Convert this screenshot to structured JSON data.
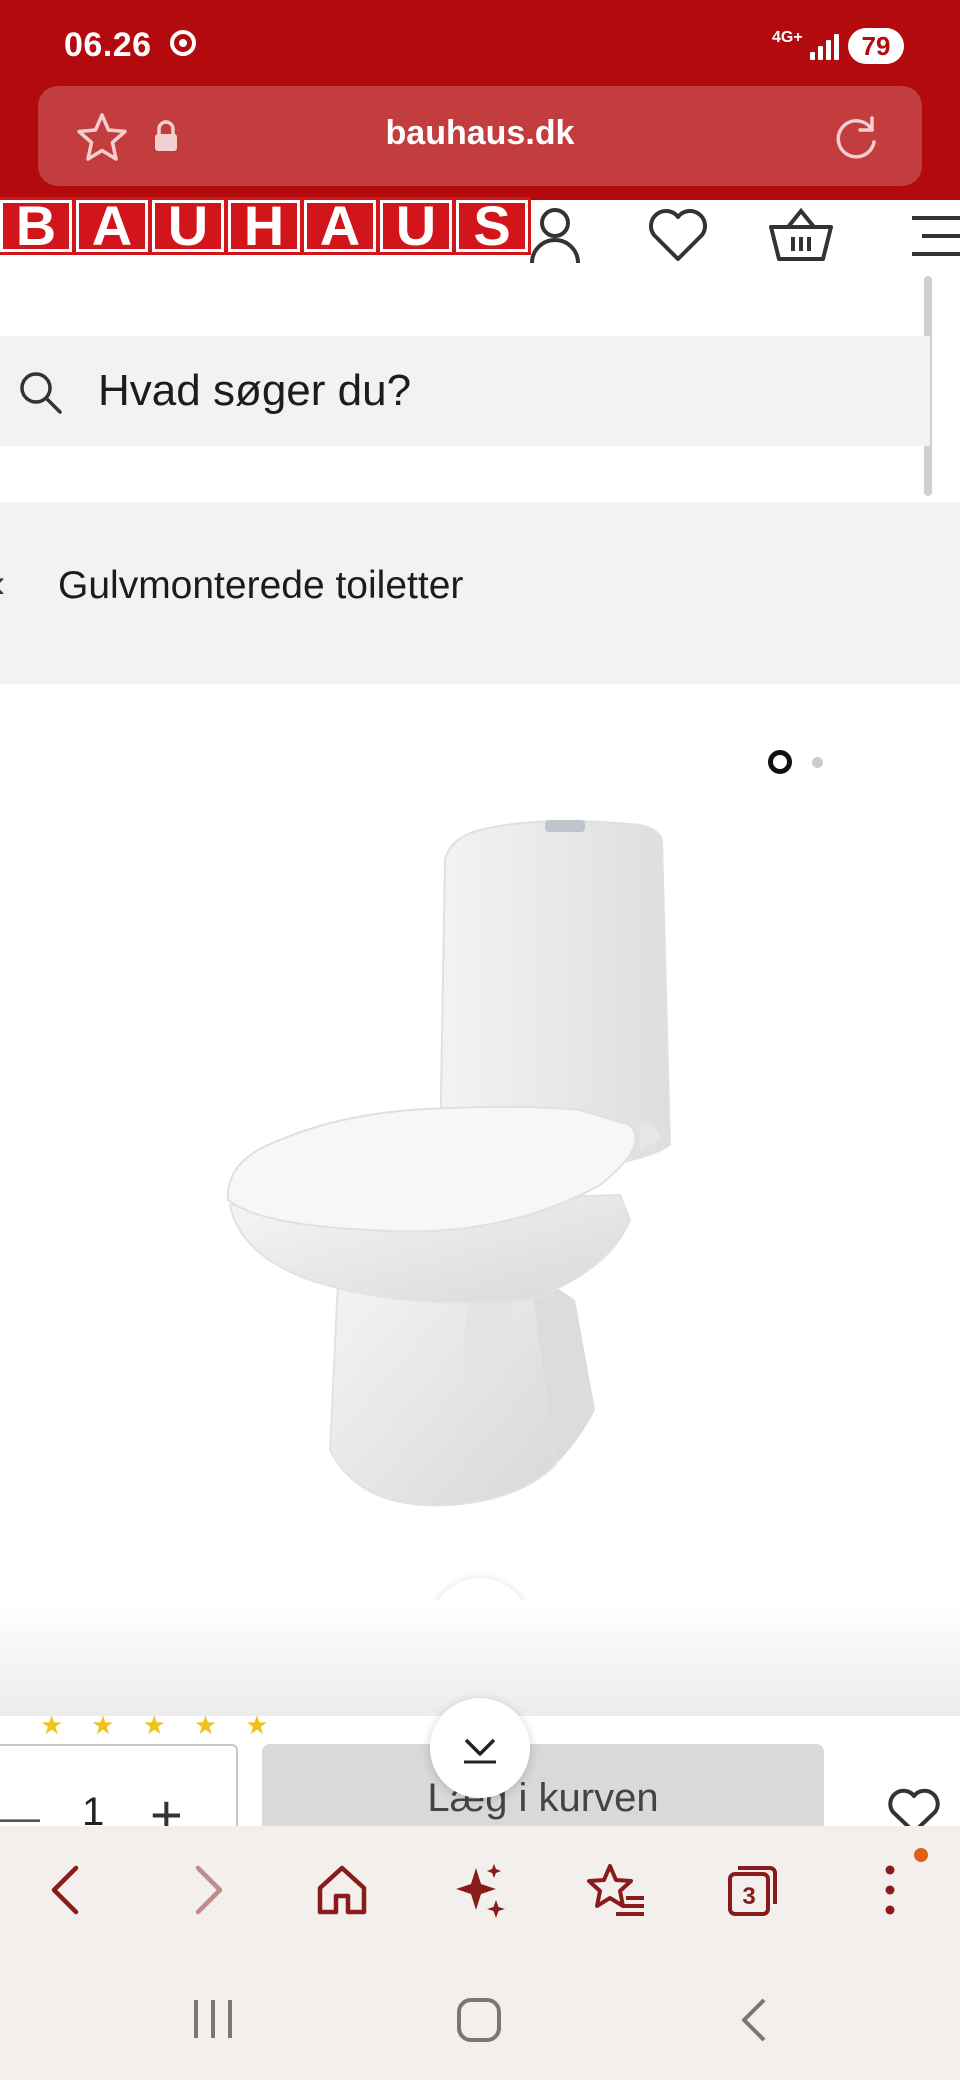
{
  "status_bar": {
    "time": "06.26",
    "network": "4G+",
    "battery": "79"
  },
  "browser": {
    "url": "bauhaus.dk",
    "colors": {
      "chrome_red": "#b30b0d",
      "url_field": "#c43d3e"
    }
  },
  "site_header": {
    "logo_text": "BAUHAUS",
    "icons": [
      "account-icon",
      "wishlist-heart-icon",
      "basket-icon",
      "menu-icon"
    ]
  },
  "search": {
    "placeholder": "Hvad søger du?"
  },
  "breadcrumb": {
    "label": "Gulvmonterede toiletter"
  },
  "gallery": {
    "pages": 2,
    "active_page": 1,
    "image": "floor-mounted-toilet"
  },
  "buy_bar": {
    "quantity": "1",
    "add_to_cart": "Læg i kurven",
    "rating_stars": 5
  },
  "browser_nav": {
    "tabs_count": "3"
  }
}
